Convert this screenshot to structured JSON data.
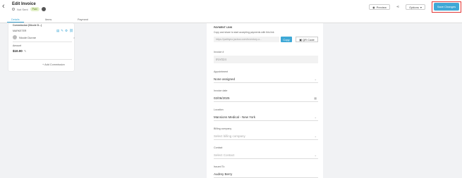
{
  "header": {
    "title": "Edit Invoice",
    "status": "Not Sent",
    "badge": "Paid",
    "back_icon": "arrow-left-icon",
    "preview_label": "Preview",
    "options_label": "Options",
    "save_label": "Save Changes"
  },
  "tabs": [
    {
      "label": "Details"
    },
    {
      "label": "Items"
    },
    {
      "label": "Payment"
    }
  ],
  "card": {
    "heading": "Commission (Nicole D...)",
    "role": "MARKETER",
    "name": "Nicole Dunne",
    "amount_label": "Amount",
    "amount": "$10.00",
    "add_label": "+ Add Commission"
  },
  "form": {
    "payment_link_label": "PAYMENT LINK",
    "payment_link_desc": "Copy and share to start accepting payments with this link",
    "payment_link_value": "https://pathlynx.jacbox.com/inventory-o...",
    "copy_label": "Copy",
    "qr_label": "QR Code",
    "invoice_no_label": "Invoice #",
    "invoice_no": "INV024",
    "appointment_label": "Appointment",
    "appointment": "None assigned",
    "invoice_date_label": "Invoice date",
    "invoice_date": "02/06/2025",
    "location_label": "Location",
    "location": "Mansions Medical - New York",
    "billing_company_label": "Billing company",
    "billing_company": "Select billing company",
    "contact_label": "Contact",
    "contact": "Select Contact",
    "issued_to_label": "Issued To",
    "issued_to": "Audrey Berry"
  },
  "colors": {
    "accent": "#3ea8d6",
    "highlight": "#e23838"
  }
}
